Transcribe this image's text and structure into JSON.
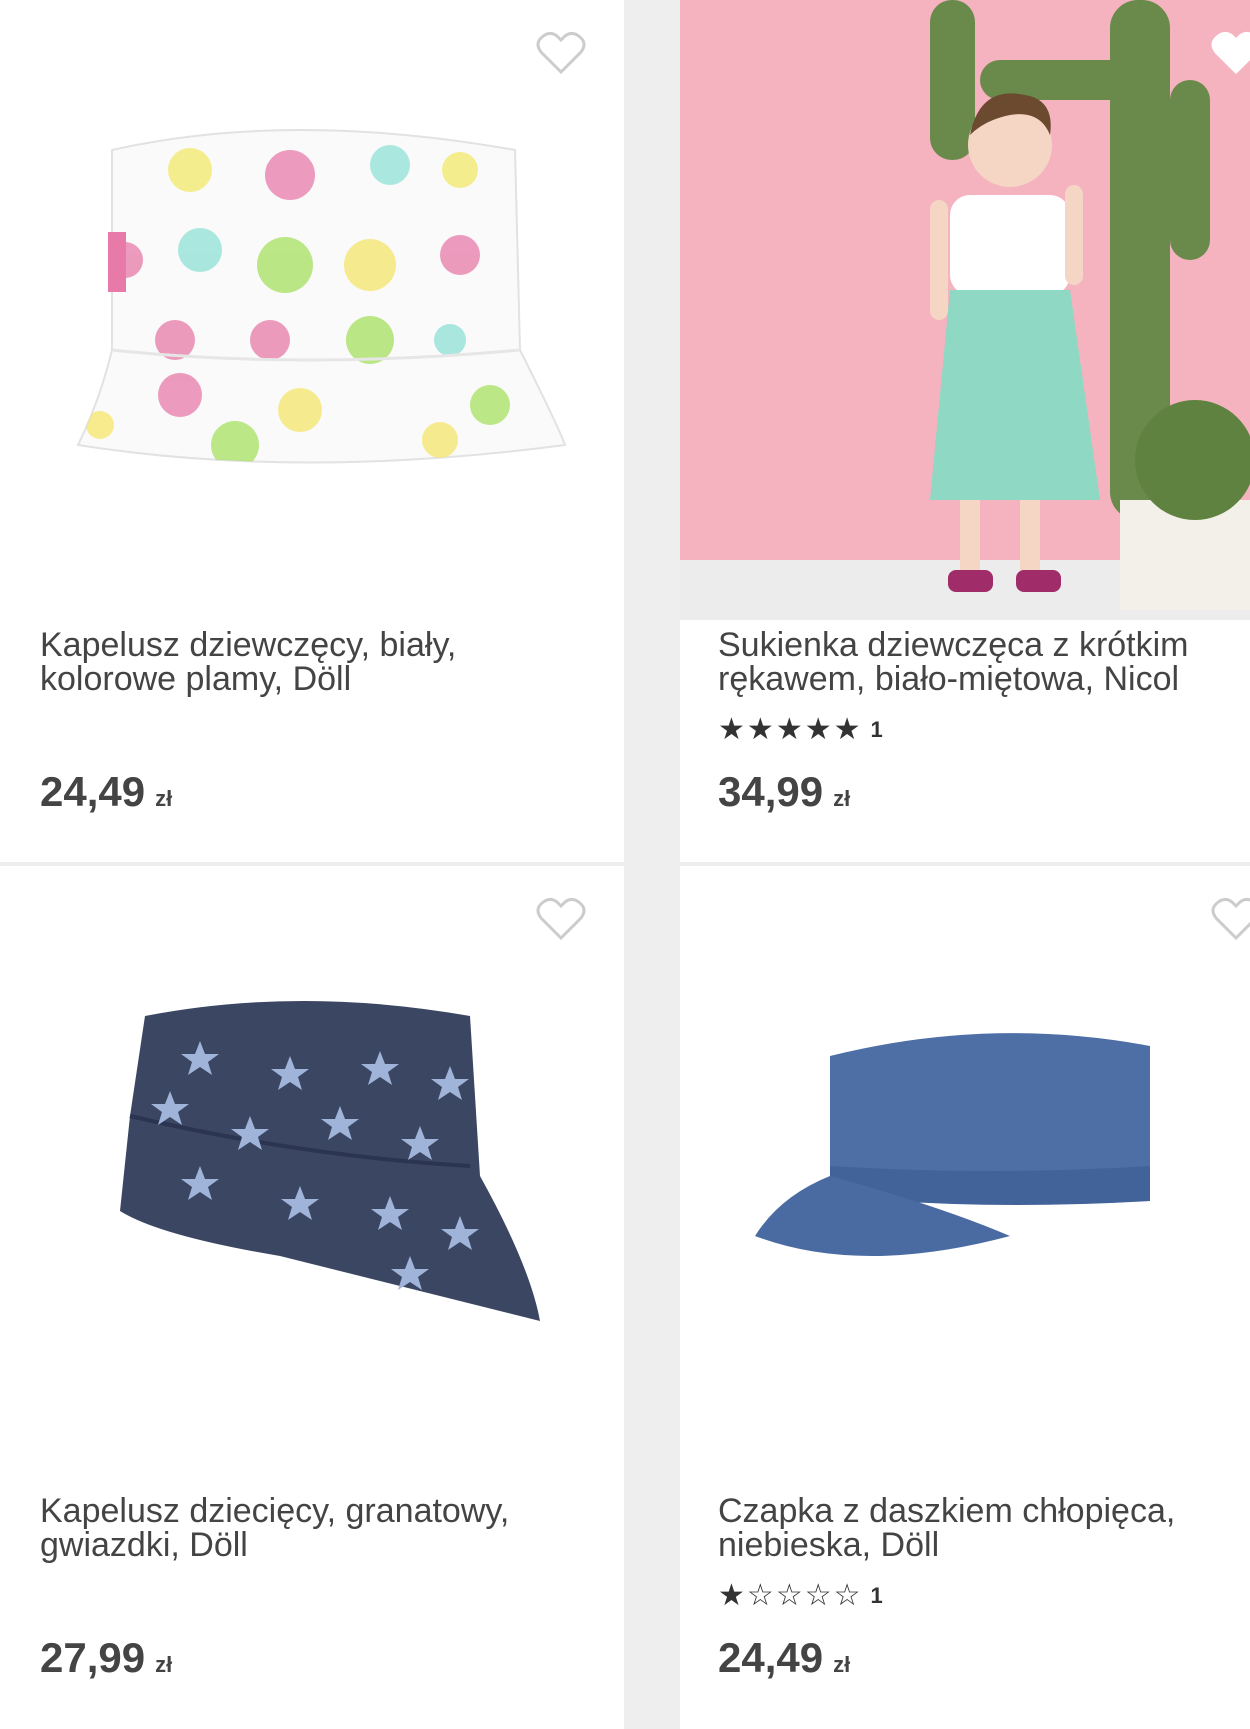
{
  "products": [
    {
      "title_line1": "Kapelusz dziewczęcy, biały,",
      "title_line2": "kolorowe plamy, Döll",
      "price": "24,49",
      "currency": "zł",
      "favorite_icon": "heart-outline-icon"
    },
    {
      "title_line1": "Sukienka dziewczęca z krótkim",
      "title_line2": "rękawem, biało-miętowa, Nicol",
      "rating": {
        "stars_filled": 5,
        "stars_total": 5,
        "count": "1"
      },
      "price": "34,99",
      "currency": "zł",
      "favorite_icon": "heart-outline-icon"
    },
    {
      "title_line1": "Kapelusz dziecięcy, granatowy,",
      "title_line2": "gwiazdki, Döll",
      "price": "27,99",
      "currency": "zł",
      "favorite_icon": "heart-outline-icon"
    },
    {
      "title_line1": "Czapka z daszkiem chłopięca,",
      "title_line2": "niebieska, Döll",
      "rating": {
        "stars_filled": 1,
        "stars_total": 5,
        "count": "1"
      },
      "price": "24,49",
      "currency": "zł",
      "favorite_icon": "heart-outline-icon"
    }
  ],
  "colors": {
    "background": "#eeeeee",
    "card": "#ffffff",
    "text": "#444444",
    "heart": "#cccccc"
  }
}
